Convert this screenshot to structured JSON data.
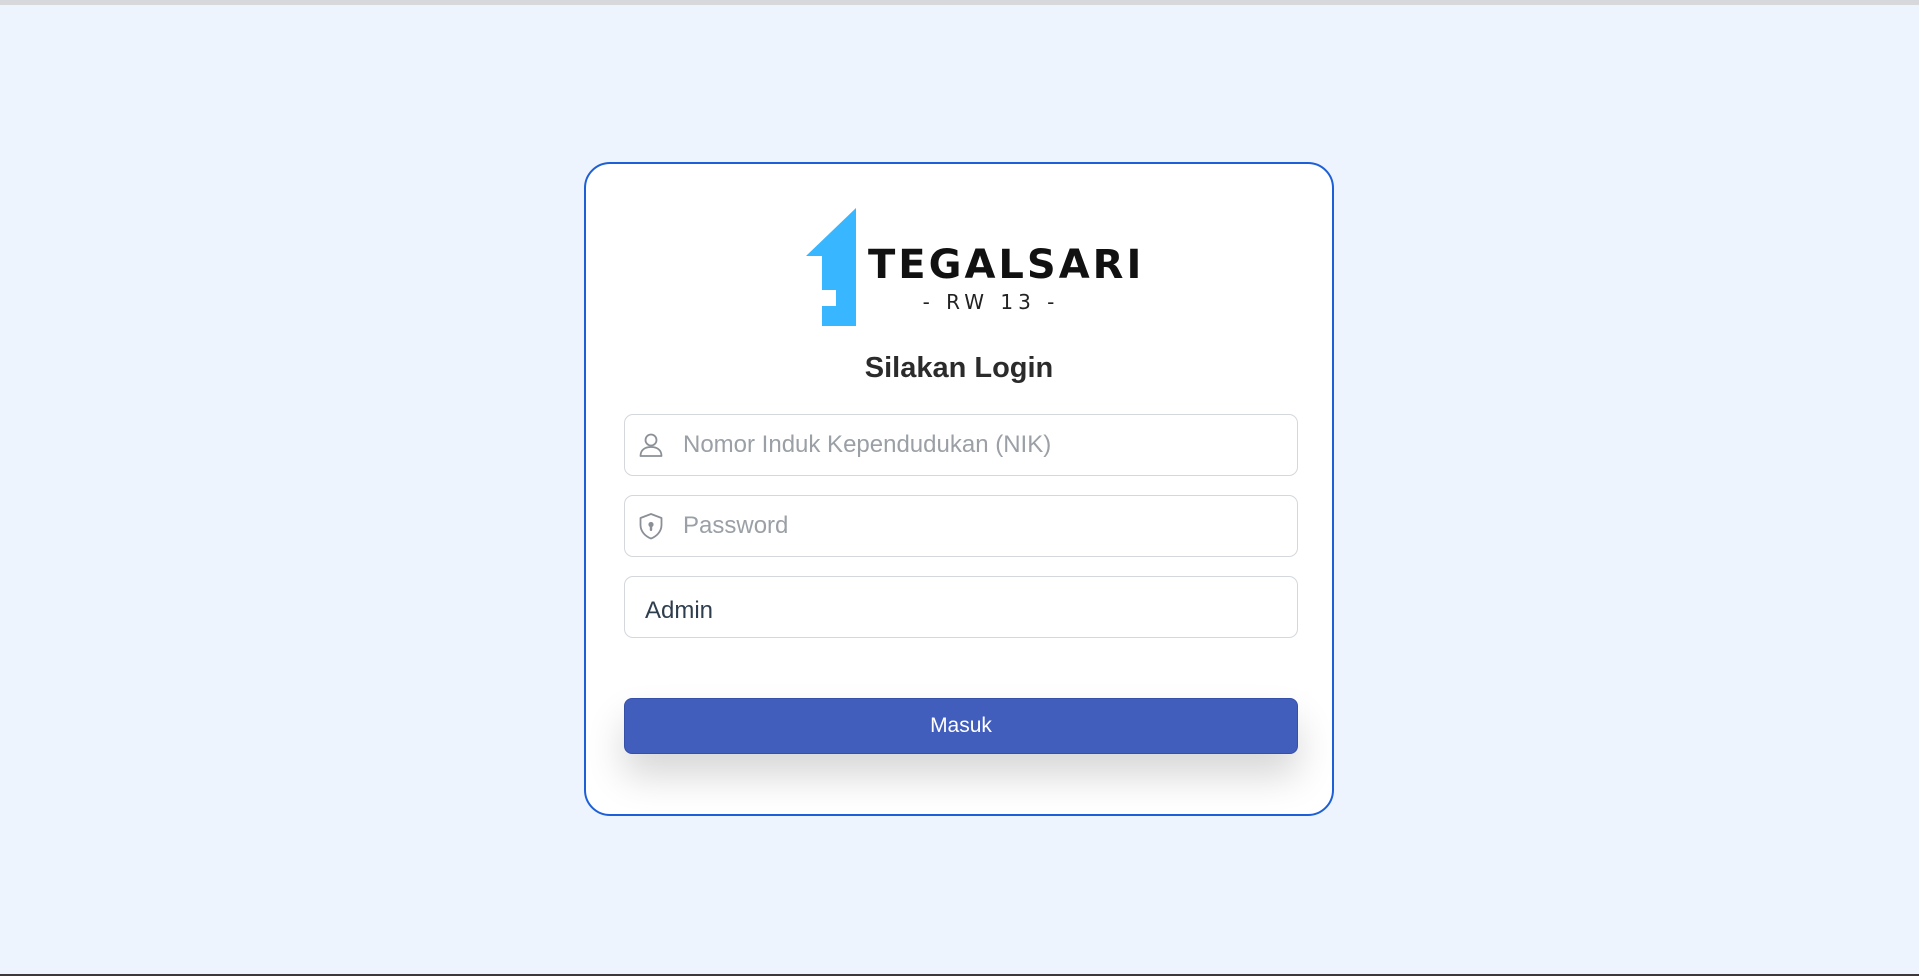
{
  "brand": {
    "name": "TEGALSARI",
    "subtitle": "- RW 13 -",
    "accent_color": "#38b6ff"
  },
  "login": {
    "title": "Silakan Login",
    "nik_placeholder": "Nomor Induk Kependudukan (NIK)",
    "nik_icon": "user-icon",
    "password_placeholder": "Password",
    "password_icon": "shield-lock-icon",
    "role_value": "Admin",
    "submit_label": "Masuk"
  },
  "colors": {
    "background": "#eef4fd",
    "card_border": "#1d5fd6",
    "button": "#425ebd"
  }
}
